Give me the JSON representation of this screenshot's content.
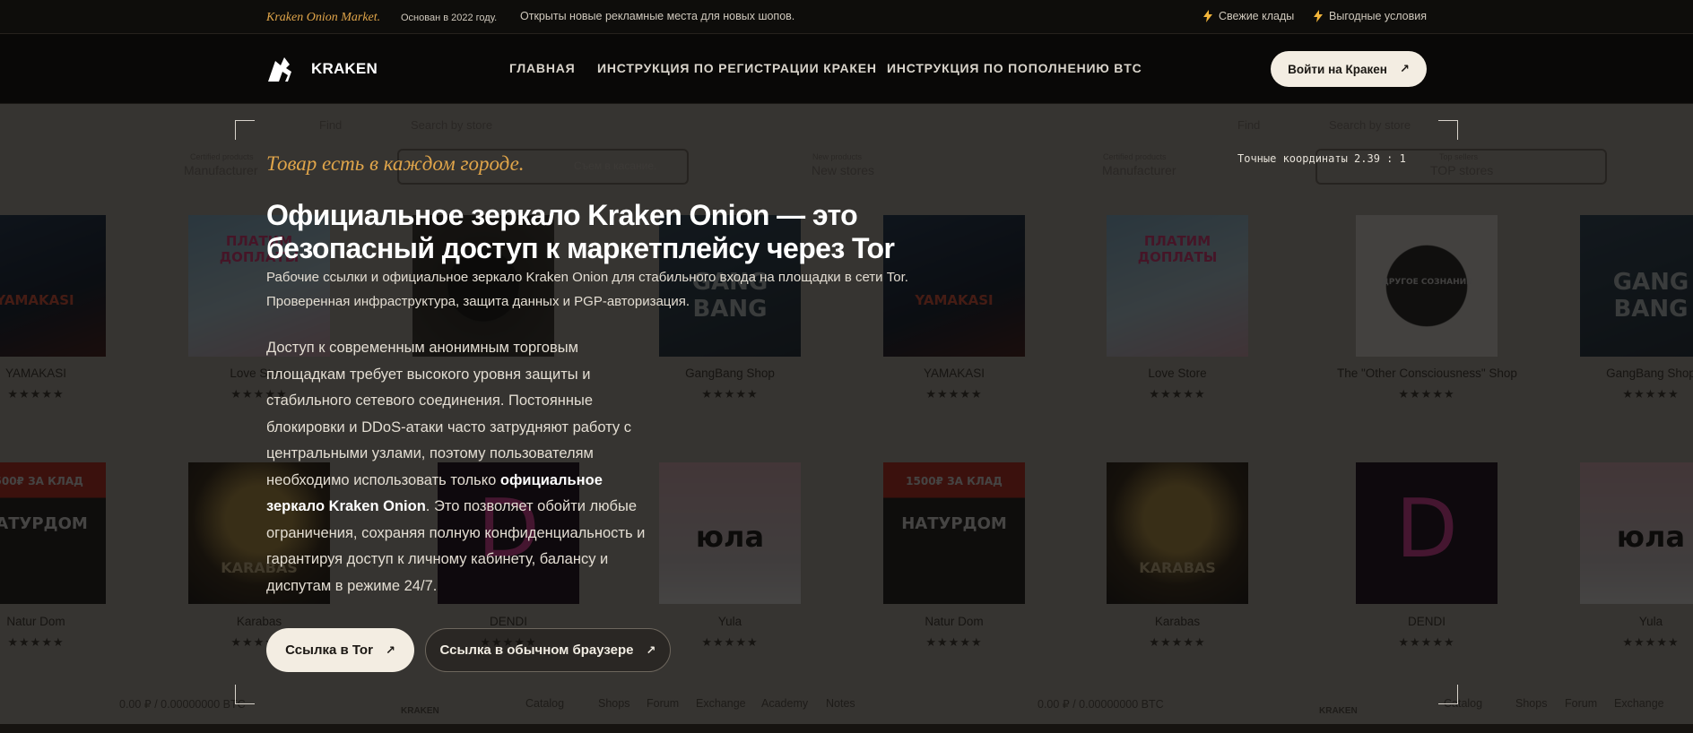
{
  "topbar": {
    "brand": "Kraken Onion Market.",
    "since": "Основан в 2022 году.",
    "ads": "Открыты новые рекламные места для новых шопов.",
    "perk1": "Свежие клады",
    "perk2": "Выгодные условия"
  },
  "header": {
    "logo_text": "KRAKEN",
    "nav": [
      "ГЛАВНАЯ",
      "ИНСТРУКЦИЯ ПО РЕГИСТРАЦИИ КРАКЕН",
      "ИНСТРУКЦИЯ ПО ПОПОЛНЕНИЮ BTC"
    ],
    "login": "Войти на Кракен",
    "login_arrow": "↗"
  },
  "hero": {
    "kicker": "Товар есть в каждом городе.",
    "title": "Официальное зеркало Kraken Onion — это безопасный доступ к маркетплейсу через Tor",
    "subtitle": "Рабочие ссылки и официальное зеркало Kraken Onion для стабильного входа на площадки в сети Tor. Проверенная инфраструктура, защита данных и PGP-авторизация.",
    "body_part1": "Доступ к современным анонимным торговым площадкам требует высокого уровня защиты и стабильного сетевого соединения. Постоянные блокировки и DDoS-атаки часто затрудняют работу с центральными узлами, поэтому пользователям необходимо использовать только ",
    "body_bold": "официальное зеркало Kraken Onion",
    "body_part2": ". Это позволяет обойти любые ограничения, сохраняя полную конфиденциальность и гарантируя доступ к личному кабинету, балансу и диспутам в режиме 24/7.",
    "coords": "Точные координаты  2.39 : 1",
    "btn_tor": "Ссылка в Tor",
    "btn_browser": "Ссылка в обычном браузере",
    "btn_arrow": "↗"
  },
  "background": {
    "search_hint": "Съем в касание.",
    "tabs": [
      "Manufacturer",
      "New stores",
      "Manufacturer",
      "TOP stores"
    ],
    "tab_small": [
      "Certified products",
      "New products",
      "Certified products",
      "Top sellers"
    ],
    "ghost_find": "Find",
    "ghost_search": "Search by store",
    "shops_row1": [
      "YAMAKASI",
      "Love Store",
      "GangBang Shop",
      "YAMAKASI",
      "Love Store",
      "The \"Other Consciousness\" Shop",
      "GangBang Shop"
    ],
    "shops_row2": [
      "Natur Dom",
      "Karabas",
      "DENDI",
      "Yula",
      "Natur Dom",
      "Karabas",
      "DENDI",
      "Yula"
    ],
    "stars": "★★★★★",
    "bottom": {
      "balance": "0.00 ₽ / 0.00000000 BTC",
      "logo": "KRAKEN",
      "links": [
        "Catalog",
        "Shops",
        "Forum",
        "Exchange",
        "Academy",
        "Notes"
      ]
    },
    "tile_texts": {
      "yamakasi": "YAMAKASI",
      "love": "ПЛАТИМ ДОПЛАТЫ",
      "gang": "GANG BANG",
      "nd_price": "1500₽ ЗА КЛАД",
      "nd_name": "НАТУРДОМ",
      "karabas": "KARABAS",
      "dendi": "D",
      "yula": "юла",
      "other": "ДРУГОЕ СОЗНАНИЕ"
    }
  },
  "colors": {
    "accent": "#e0a54a",
    "bg": "#0d0c0b",
    "button": "#f3ede2"
  }
}
